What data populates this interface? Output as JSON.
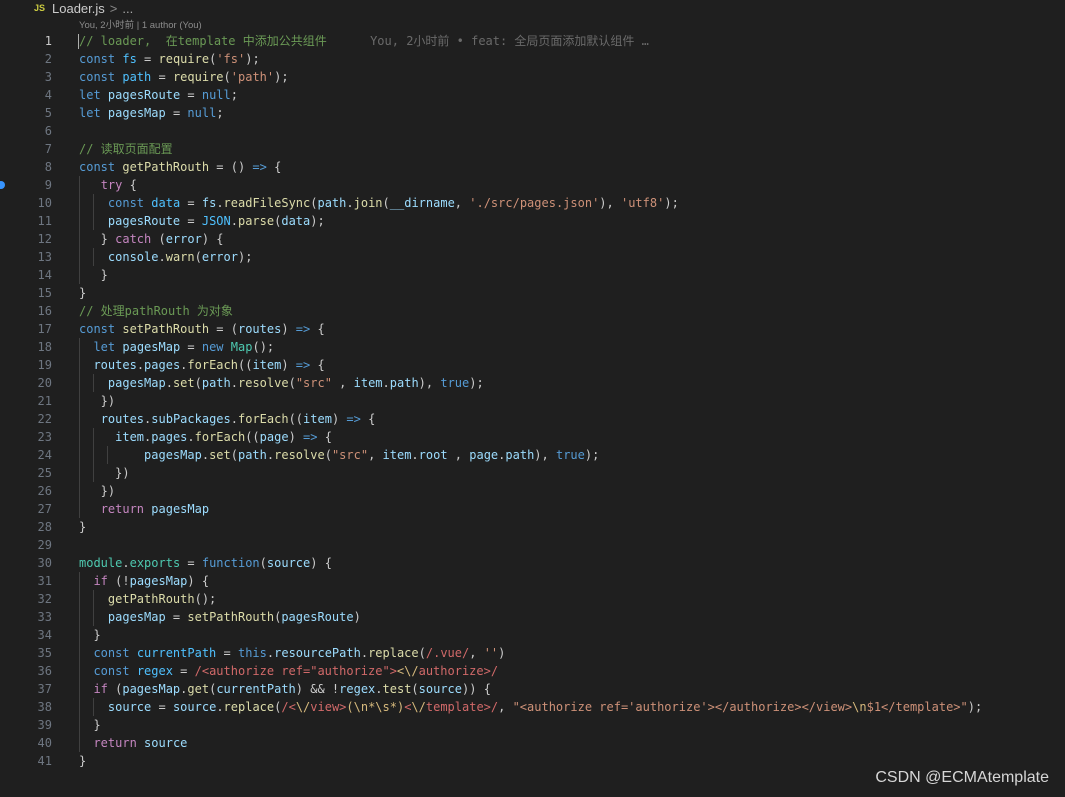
{
  "breadcrumb": {
    "file_icon": "JS",
    "file_name": "Loader.js",
    "separator": ">",
    "ellipsis": "..."
  },
  "blame_header": "You, 2小时前 | 1 author (You)",
  "inline_blame": "You, 2小时前 • feat: 全局页面添加默认组件 …",
  "watermark": "CSDN @ECMAtemplate",
  "colors": {
    "background": "#1f1f1f",
    "keyword": "#569cd6",
    "control": "#c586c0",
    "variable": "#9cdcfe",
    "constant": "#4fc1ff",
    "function": "#dcdcaa",
    "string": "#ce9178",
    "comment": "#6a9955",
    "class": "#4ec9b0",
    "regex": "#d16969",
    "breakpoint": "#3794ff"
  },
  "lines": [
    {
      "n": "1",
      "active": true,
      "guides": 0,
      "tokens": [
        [
          "cmt",
          "// loader,  在template 中添加公共组件"
        ]
      ],
      "blame": true
    },
    {
      "n": "2",
      "guides": 0,
      "tokens": [
        [
          "kw",
          "const"
        ],
        [
          "pun",
          " "
        ],
        [
          "cst",
          "fs"
        ],
        [
          "pun",
          " = "
        ],
        [
          "fn",
          "require"
        ],
        [
          "pun",
          "("
        ],
        [
          "str",
          "'fs'"
        ],
        [
          "pun",
          ");"
        ]
      ]
    },
    {
      "n": "3",
      "guides": 0,
      "tokens": [
        [
          "kw",
          "const"
        ],
        [
          "pun",
          " "
        ],
        [
          "cst",
          "path"
        ],
        [
          "pun",
          " = "
        ],
        [
          "fn",
          "require"
        ],
        [
          "pun",
          "("
        ],
        [
          "str",
          "'path'"
        ],
        [
          "pun",
          ");"
        ]
      ]
    },
    {
      "n": "4",
      "guides": 0,
      "tokens": [
        [
          "kw",
          "let"
        ],
        [
          "pun",
          " "
        ],
        [
          "var",
          "pagesRoute"
        ],
        [
          "pun",
          " = "
        ],
        [
          "kw",
          "null"
        ],
        [
          "pun",
          ";"
        ]
      ]
    },
    {
      "n": "5",
      "guides": 0,
      "tokens": [
        [
          "kw",
          "let"
        ],
        [
          "pun",
          " "
        ],
        [
          "var",
          "pagesMap"
        ],
        [
          "pun",
          " = "
        ],
        [
          "kw",
          "null"
        ],
        [
          "pun",
          ";"
        ]
      ]
    },
    {
      "n": "6",
      "guides": 0,
      "tokens": []
    },
    {
      "n": "7",
      "guides": 0,
      "tokens": [
        [
          "cmt",
          "// 读取页面配置"
        ]
      ]
    },
    {
      "n": "8",
      "guides": 0,
      "tokens": [
        [
          "kw",
          "const"
        ],
        [
          "pun",
          " "
        ],
        [
          "fn",
          "getPathRouth"
        ],
        [
          "pun",
          " = () "
        ],
        [
          "kw",
          "=>"
        ],
        [
          "pun",
          " {"
        ]
      ]
    },
    {
      "n": "9",
      "guides": 1,
      "bp": true,
      "tokens": [
        [
          "pun",
          "   "
        ],
        [
          "ctrl",
          "try"
        ],
        [
          "pun",
          " {"
        ]
      ]
    },
    {
      "n": "10",
      "guides": 2,
      "tokens": [
        [
          "pun",
          "    "
        ],
        [
          "kw",
          "const"
        ],
        [
          "pun",
          " "
        ],
        [
          "cst",
          "data"
        ],
        [
          "pun",
          " = "
        ],
        [
          "var",
          "fs"
        ],
        [
          "pun",
          "."
        ],
        [
          "fn",
          "readFileSync"
        ],
        [
          "pun",
          "("
        ],
        [
          "var",
          "path"
        ],
        [
          "pun",
          "."
        ],
        [
          "fn",
          "join"
        ],
        [
          "pun",
          "("
        ],
        [
          "var",
          "__dirname"
        ],
        [
          "pun",
          ", "
        ],
        [
          "str",
          "'./src/pages.json'"
        ],
        [
          "pun",
          "), "
        ],
        [
          "str",
          "'utf8'"
        ],
        [
          "pun",
          ");"
        ]
      ]
    },
    {
      "n": "11",
      "guides": 2,
      "tokens": [
        [
          "pun",
          "    "
        ],
        [
          "var",
          "pagesRoute"
        ],
        [
          "pun",
          " = "
        ],
        [
          "cst",
          "JSON"
        ],
        [
          "pun",
          "."
        ],
        [
          "fn",
          "parse"
        ],
        [
          "pun",
          "("
        ],
        [
          "var",
          "data"
        ],
        [
          "pun",
          ");"
        ]
      ]
    },
    {
      "n": "12",
      "guides": 1,
      "tokens": [
        [
          "pun",
          "   } "
        ],
        [
          "ctrl",
          "catch"
        ],
        [
          "pun",
          " ("
        ],
        [
          "var",
          "error"
        ],
        [
          "pun",
          ") {"
        ]
      ]
    },
    {
      "n": "13",
      "guides": 2,
      "tokens": [
        [
          "pun",
          "    "
        ],
        [
          "var",
          "console"
        ],
        [
          "pun",
          "."
        ],
        [
          "fn",
          "warn"
        ],
        [
          "pun",
          "("
        ],
        [
          "var",
          "error"
        ],
        [
          "pun",
          ");"
        ]
      ]
    },
    {
      "n": "14",
      "guides": 1,
      "tokens": [
        [
          "pun",
          "   }"
        ]
      ]
    },
    {
      "n": "15",
      "guides": 0,
      "tokens": [
        [
          "pun",
          "}"
        ]
      ]
    },
    {
      "n": "16",
      "guides": 0,
      "tokens": [
        [
          "cmt",
          "// 处理pathRouth 为对象"
        ]
      ]
    },
    {
      "n": "17",
      "guides": 0,
      "tokens": [
        [
          "kw",
          "const"
        ],
        [
          "pun",
          " "
        ],
        [
          "fn",
          "setPathRouth"
        ],
        [
          "pun",
          " = ("
        ],
        [
          "var",
          "routes"
        ],
        [
          "pun",
          ") "
        ],
        [
          "kw",
          "=>"
        ],
        [
          "pun",
          " {"
        ]
      ]
    },
    {
      "n": "18",
      "guides": 1,
      "tokens": [
        [
          "pun",
          "  "
        ],
        [
          "kw",
          "let"
        ],
        [
          "pun",
          " "
        ],
        [
          "var",
          "pagesMap"
        ],
        [
          "pun",
          " = "
        ],
        [
          "kw",
          "new"
        ],
        [
          "pun",
          " "
        ],
        [
          "cls",
          "Map"
        ],
        [
          "pun",
          "();"
        ]
      ]
    },
    {
      "n": "19",
      "guides": 1,
      "tokens": [
        [
          "pun",
          "  "
        ],
        [
          "var",
          "routes"
        ],
        [
          "pun",
          "."
        ],
        [
          "var",
          "pages"
        ],
        [
          "pun",
          "."
        ],
        [
          "fn",
          "forEach"
        ],
        [
          "pun",
          "(("
        ],
        [
          "var",
          "item"
        ],
        [
          "pun",
          ") "
        ],
        [
          "kw",
          "=>"
        ],
        [
          "pun",
          " {"
        ]
      ]
    },
    {
      "n": "20",
      "guides": 2,
      "tokens": [
        [
          "pun",
          "    "
        ],
        [
          "var",
          "pagesMap"
        ],
        [
          "pun",
          "."
        ],
        [
          "fn",
          "set"
        ],
        [
          "pun",
          "("
        ],
        [
          "var",
          "path"
        ],
        [
          "pun",
          "."
        ],
        [
          "fn",
          "resolve"
        ],
        [
          "pun",
          "("
        ],
        [
          "str",
          "\"src\""
        ],
        [
          "pun",
          " , "
        ],
        [
          "var",
          "item"
        ],
        [
          "pun",
          "."
        ],
        [
          "var",
          "path"
        ],
        [
          "pun",
          "), "
        ],
        [
          "kw",
          "true"
        ],
        [
          "pun",
          ");"
        ]
      ]
    },
    {
      "n": "21",
      "guides": 1,
      "tokens": [
        [
          "pun",
          "   })"
        ]
      ]
    },
    {
      "n": "22",
      "guides": 1,
      "tokens": [
        [
          "pun",
          "   "
        ],
        [
          "var",
          "routes"
        ],
        [
          "pun",
          "."
        ],
        [
          "var",
          "subPackages"
        ],
        [
          "pun",
          "."
        ],
        [
          "fn",
          "forEach"
        ],
        [
          "pun",
          "(("
        ],
        [
          "var",
          "item"
        ],
        [
          "pun",
          ") "
        ],
        [
          "kw",
          "=>"
        ],
        [
          "pun",
          " {"
        ]
      ]
    },
    {
      "n": "23",
      "guides": 2,
      "tokens": [
        [
          "pun",
          "     "
        ],
        [
          "var",
          "item"
        ],
        [
          "pun",
          "."
        ],
        [
          "var",
          "pages"
        ],
        [
          "pun",
          "."
        ],
        [
          "fn",
          "forEach"
        ],
        [
          "pun",
          "(("
        ],
        [
          "var",
          "page"
        ],
        [
          "pun",
          ") "
        ],
        [
          "kw",
          "=>"
        ],
        [
          "pun",
          " {"
        ]
      ]
    },
    {
      "n": "24",
      "guides": 3,
      "tokens": [
        [
          "pun",
          "         "
        ],
        [
          "var",
          "pagesMap"
        ],
        [
          "pun",
          "."
        ],
        [
          "fn",
          "set"
        ],
        [
          "pun",
          "("
        ],
        [
          "var",
          "path"
        ],
        [
          "pun",
          "."
        ],
        [
          "fn",
          "resolve"
        ],
        [
          "pun",
          "("
        ],
        [
          "str",
          "\"src\""
        ],
        [
          "pun",
          ", "
        ],
        [
          "var",
          "item"
        ],
        [
          "pun",
          "."
        ],
        [
          "var",
          "root"
        ],
        [
          "pun",
          " , "
        ],
        [
          "var",
          "page"
        ],
        [
          "pun",
          "."
        ],
        [
          "var",
          "path"
        ],
        [
          "pun",
          "), "
        ],
        [
          "kw",
          "true"
        ],
        [
          "pun",
          ");"
        ]
      ]
    },
    {
      "n": "25",
      "guides": 2,
      "tokens": [
        [
          "pun",
          "     })"
        ]
      ]
    },
    {
      "n": "26",
      "guides": 1,
      "tokens": [
        [
          "pun",
          "   })"
        ]
      ]
    },
    {
      "n": "27",
      "guides": 1,
      "tokens": [
        [
          "pun",
          "   "
        ],
        [
          "ctrl",
          "return"
        ],
        [
          "pun",
          " "
        ],
        [
          "var",
          "pagesMap"
        ]
      ]
    },
    {
      "n": "28",
      "guides": 0,
      "tokens": [
        [
          "pun",
          "}"
        ]
      ]
    },
    {
      "n": "29",
      "guides": 0,
      "tokens": []
    },
    {
      "n": "30",
      "guides": 0,
      "tokens": [
        [
          "cls",
          "module"
        ],
        [
          "pun",
          "."
        ],
        [
          "cls",
          "exports"
        ],
        [
          "pun",
          " = "
        ],
        [
          "kw",
          "function"
        ],
        [
          "pun",
          "("
        ],
        [
          "var",
          "source"
        ],
        [
          "pun",
          ") {"
        ]
      ]
    },
    {
      "n": "31",
      "guides": 1,
      "tokens": [
        [
          "pun",
          "  "
        ],
        [
          "ctrl",
          "if"
        ],
        [
          "pun",
          " (!"
        ],
        [
          "var",
          "pagesMap"
        ],
        [
          "pun",
          ") {"
        ]
      ]
    },
    {
      "n": "32",
      "guides": 2,
      "tokens": [
        [
          "pun",
          "    "
        ],
        [
          "fn",
          "getPathRouth"
        ],
        [
          "pun",
          "();"
        ]
      ]
    },
    {
      "n": "33",
      "guides": 2,
      "tokens": [
        [
          "pun",
          "    "
        ],
        [
          "var",
          "pagesMap"
        ],
        [
          "pun",
          " = "
        ],
        [
          "fn",
          "setPathRouth"
        ],
        [
          "pun",
          "("
        ],
        [
          "var",
          "pagesRoute"
        ],
        [
          "pun",
          ")"
        ]
      ]
    },
    {
      "n": "34",
      "guides": 1,
      "tokens": [
        [
          "pun",
          "  }"
        ]
      ]
    },
    {
      "n": "35",
      "guides": 1,
      "tokens": [
        [
          "pun",
          "  "
        ],
        [
          "kw",
          "const"
        ],
        [
          "pun",
          " "
        ],
        [
          "cst",
          "currentPath"
        ],
        [
          "pun",
          " = "
        ],
        [
          "kw",
          "this"
        ],
        [
          "pun",
          "."
        ],
        [
          "var",
          "resourcePath"
        ],
        [
          "pun",
          "."
        ],
        [
          "fn",
          "replace"
        ],
        [
          "pun",
          "("
        ],
        [
          "re",
          "/.vue/"
        ],
        [
          "pun",
          ", "
        ],
        [
          "str",
          "''"
        ],
        [
          "pun",
          ")"
        ]
      ]
    },
    {
      "n": "36",
      "guides": 1,
      "tokens": [
        [
          "pun",
          "  "
        ],
        [
          "kw",
          "const"
        ],
        [
          "pun",
          " "
        ],
        [
          "cst",
          "regex"
        ],
        [
          "pun",
          " = "
        ],
        [
          "re",
          "/<authorize ref=\"authorize\">"
        ],
        [
          "esc",
          "<\\/"
        ],
        [
          "re",
          "authorize>/"
        ]
      ]
    },
    {
      "n": "37",
      "guides": 1,
      "tokens": [
        [
          "pun",
          "  "
        ],
        [
          "ctrl",
          "if"
        ],
        [
          "pun",
          " ("
        ],
        [
          "var",
          "pagesMap"
        ],
        [
          "pun",
          "."
        ],
        [
          "fn",
          "get"
        ],
        [
          "pun",
          "("
        ],
        [
          "var",
          "currentPath"
        ],
        [
          "pun",
          ") && !"
        ],
        [
          "var",
          "regex"
        ],
        [
          "pun",
          "."
        ],
        [
          "fn",
          "test"
        ],
        [
          "pun",
          "("
        ],
        [
          "var",
          "source"
        ],
        [
          "pun",
          ")) {"
        ]
      ]
    },
    {
      "n": "38",
      "guides": 2,
      "tokens": [
        [
          "pun",
          "    "
        ],
        [
          "var",
          "source"
        ],
        [
          "pun",
          " = "
        ],
        [
          "var",
          "source"
        ],
        [
          "pun",
          "."
        ],
        [
          "fn",
          "replace"
        ],
        [
          "pun",
          "("
        ],
        [
          "re",
          "/<"
        ],
        [
          "esc",
          "\\/"
        ],
        [
          "re",
          "view>"
        ],
        [
          "esc",
          "(\\n*\\s*)"
        ],
        [
          "re",
          "<"
        ],
        [
          "esc",
          "\\/"
        ],
        [
          "re",
          "template>/"
        ],
        [
          "pun",
          ", "
        ],
        [
          "str",
          "\"<authorize ref='authorize'></authorize></view>"
        ],
        [
          "esc",
          "\\n"
        ],
        [
          "str",
          "$1</template>\""
        ],
        [
          "pun",
          ");"
        ]
      ]
    },
    {
      "n": "39",
      "guides": 1,
      "tokens": [
        [
          "pun",
          "  }"
        ]
      ]
    },
    {
      "n": "40",
      "guides": 1,
      "tokens": [
        [
          "pun",
          "  "
        ],
        [
          "ctrl",
          "return"
        ],
        [
          "pun",
          " "
        ],
        [
          "var",
          "source"
        ]
      ]
    },
    {
      "n": "41",
      "guides": 0,
      "tokens": [
        [
          "pun",
          "}"
        ]
      ]
    }
  ]
}
